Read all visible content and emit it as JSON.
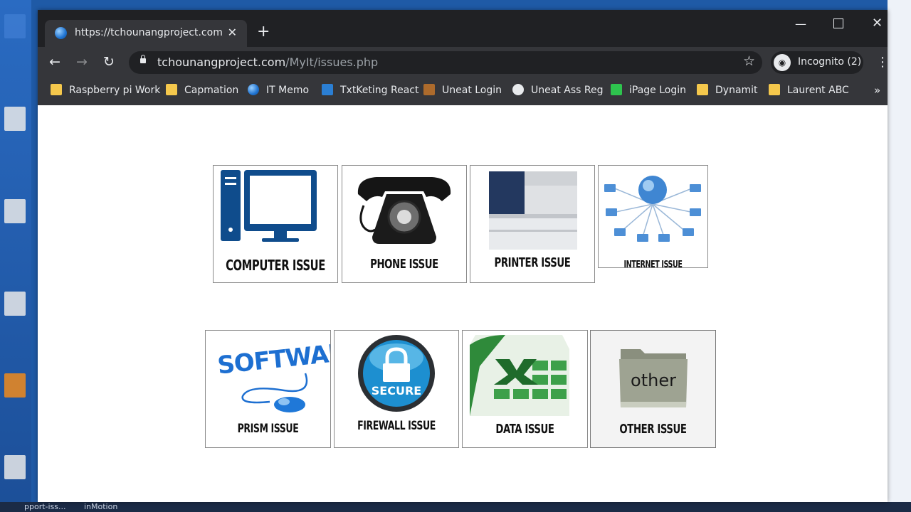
{
  "browser": {
    "tab_title": "https://tchounangproject.com/M",
    "new_tab_glyph": "+",
    "url_host": "tchounangproject.com",
    "url_path": "/MyIt/issues.php",
    "profile_label": "Incognito (2)",
    "back_glyph": "←",
    "forward_glyph": "→",
    "reload_glyph": "↻",
    "star_glyph": "☆",
    "menu_glyph": "⋮",
    "close_glyph": "✕",
    "minimize_glyph": "—"
  },
  "bookmarks": {
    "items": [
      {
        "label": "Raspberry pi Work",
        "icon": "folder-icon"
      },
      {
        "label": "Capmation",
        "icon": "folder-icon"
      },
      {
        "label": "IT Memo",
        "icon": "globe-icon"
      },
      {
        "label": "TxtKeting React",
        "icon": "react-icon"
      },
      {
        "label": "Uneat Login",
        "icon": "ws-icon"
      },
      {
        "label": "Uneat Ass Reg",
        "icon": "globe-icon"
      },
      {
        "label": "iPage Login",
        "icon": "ipage-icon"
      },
      {
        "label": "Dynamit",
        "icon": "folder-icon"
      },
      {
        "label": "Laurent ABC",
        "icon": "folder-icon"
      }
    ],
    "more_glyph": "»"
  },
  "issues": {
    "row1": [
      {
        "label": "COMPUTER  ISSUE",
        "icon": "computer-icon"
      },
      {
        "label": "PHONE ISSUE",
        "icon": "phone-icon"
      },
      {
        "label": "PRINTER ISSUE",
        "icon": "printer-icon"
      },
      {
        "label": "INTERNET ISSUE",
        "icon": "network-icon"
      }
    ],
    "row2": [
      {
        "label": "PRISM ISSUE",
        "icon": "software-mouse-icon",
        "art_text": "SOFTWARE"
      },
      {
        "label": "FIREWALL ISSUE",
        "icon": "lock-icon",
        "art_text": "SECURE"
      },
      {
        "label": "DATA ISSUE",
        "icon": "excel-icon"
      },
      {
        "label": "OTHER ISSUE",
        "icon": "folder-icon",
        "art_text": "other"
      }
    ]
  },
  "taskbar": {
    "left_text": "pport-iss...",
    "right_text": "inMotion"
  }
}
